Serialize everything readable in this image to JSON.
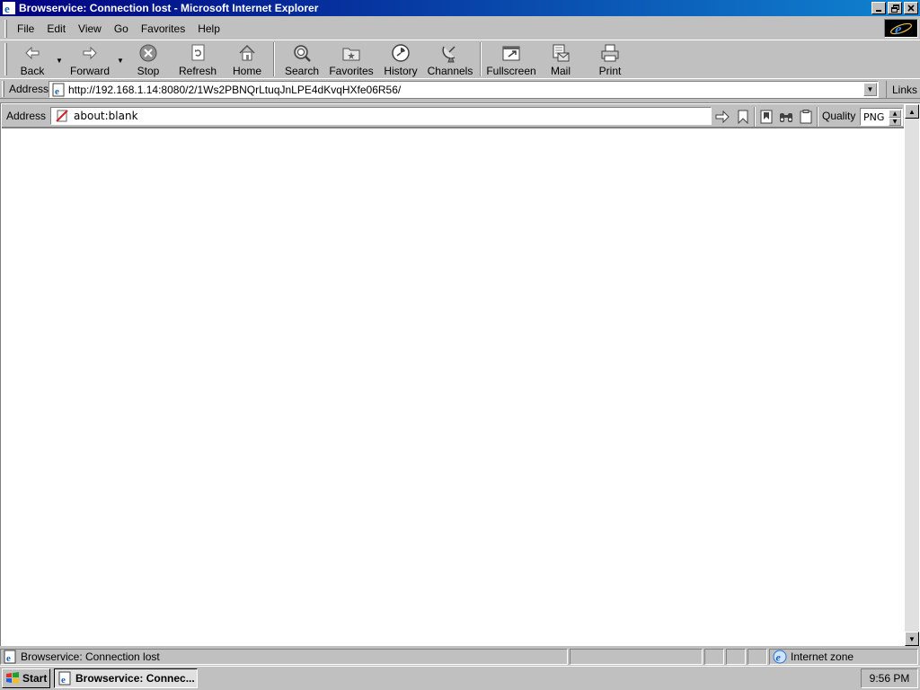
{
  "window": {
    "title": "Browservice: Connection lost - Microsoft Internet Explorer",
    "minimize_icon": "minimize-icon",
    "restore_icon": "restore-icon",
    "close_icon": "close-icon"
  },
  "menu": {
    "items": [
      {
        "label": "File"
      },
      {
        "label": "Edit"
      },
      {
        "label": "View"
      },
      {
        "label": "Go"
      },
      {
        "label": "Favorites"
      },
      {
        "label": "Help"
      }
    ]
  },
  "toolbar": {
    "buttons": [
      {
        "label": "Back",
        "icon": "back-arrow-icon"
      },
      {
        "label": "Forward",
        "icon": "forward-arrow-icon"
      },
      {
        "label": "Stop",
        "icon": "stop-icon"
      },
      {
        "label": "Refresh",
        "icon": "refresh-icon"
      },
      {
        "label": "Home",
        "icon": "home-icon"
      },
      {
        "label": "Search",
        "icon": "search-icon"
      },
      {
        "label": "Favorites",
        "icon": "favorites-folder-icon"
      },
      {
        "label": "History",
        "icon": "history-icon"
      },
      {
        "label": "Channels",
        "icon": "channels-icon"
      },
      {
        "label": "Fullscreen",
        "icon": "fullscreen-icon"
      },
      {
        "label": "Mail",
        "icon": "mail-icon"
      },
      {
        "label": "Print",
        "icon": "print-icon"
      }
    ]
  },
  "address_bar": {
    "label": "Address",
    "url": "http://192.168.1.14:8080/2/1Ws2PBNQrLtuqJnLPE4dKvqHXfe06R56/",
    "links_label": "Links"
  },
  "browservice": {
    "address_label": "Address",
    "url": "about:blank",
    "quality_label": "Quality",
    "quality_value": "PNG"
  },
  "statusbar": {
    "text": "Browservice: Connection lost",
    "zone": "Internet zone"
  },
  "taskbar": {
    "start_label": "Start",
    "task_label": "Browservice: Connec...",
    "clock": "9:56 PM"
  },
  "colors": {
    "titlebar_start": "#000080",
    "titlebar_end": "#1084d0",
    "face": "#c0c0c0"
  }
}
